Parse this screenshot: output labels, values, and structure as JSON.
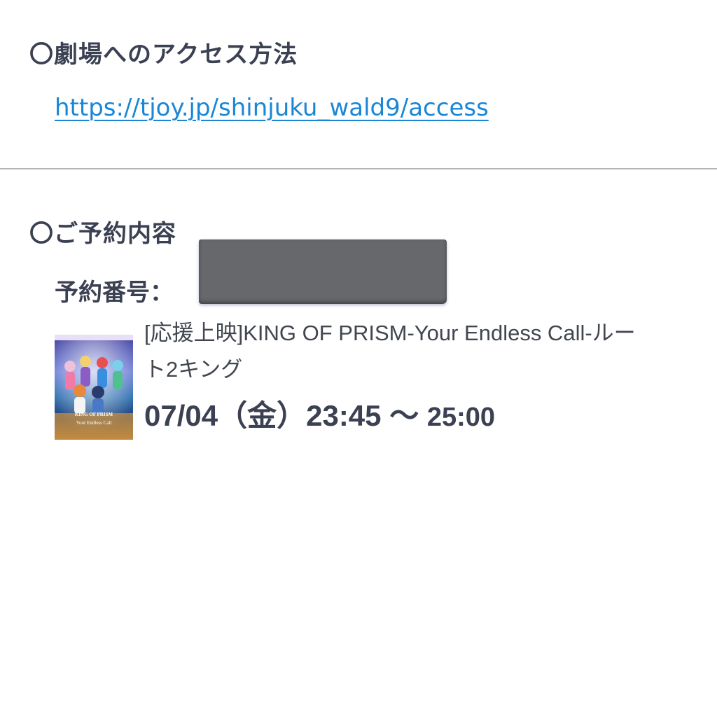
{
  "access": {
    "title": "〇劇場へのアクセス方法",
    "link_text": "https://tjoy.jp/shinjuku_wald9/access"
  },
  "reservation": {
    "title": "〇ご予約内容",
    "number_label": "予約番号：",
    "movie": {
      "title": "[応援上映]KING OF PRISM-Your Endless Call-ルート2キング",
      "poster_logo_text": "KING OF PRISM",
      "poster_sub_text": "Your Endless Call"
    },
    "showtime": {
      "start": "07/04（金）23:45 〜 ",
      "end": "25:00"
    }
  },
  "colors": {
    "link": "#1a86d6",
    "text": "#3b4152",
    "divider": "#b5b5b5",
    "redaction": "#67686c"
  }
}
